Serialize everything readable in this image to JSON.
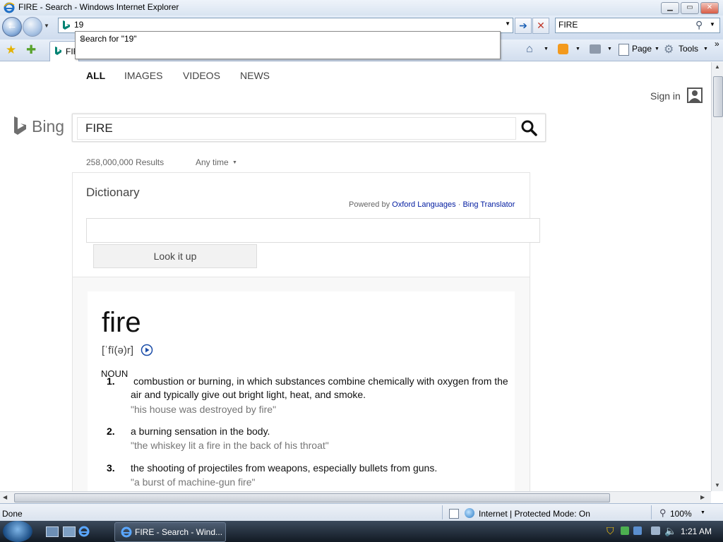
{
  "window": {
    "title": "FIRE - Search - Windows Internet Explorer",
    "controls": {
      "minimize": "▁",
      "maximize": "▭",
      "close": "✕"
    }
  },
  "navbar": {
    "back_glyph": "←",
    "address_value": "19",
    "go_glyph": "➔",
    "stop_glyph": "✕",
    "search_value": "FIRE",
    "search_glyph": "⚲"
  },
  "autocomplete": {
    "suggestion": "Search for \"19\""
  },
  "tab": {
    "label": "FIF"
  },
  "commands": {
    "page": "Page",
    "tools": "Tools",
    "more": "»"
  },
  "bing": {
    "nav": [
      "ALL",
      "IMAGES",
      "VIDEOS",
      "NEWS"
    ],
    "sign_in": "Sign in",
    "logo_text": "Bing",
    "query": "FIRE",
    "results_count": "258,000,000 Results",
    "any_time": "Any time"
  },
  "dictionary": {
    "title": "Dictionary",
    "powered_by": "Powered by",
    "provider": "Oxford Languages",
    "separator": "·",
    "translator": "Bing Translator",
    "lookup_placeholder": "",
    "lookup_button": "Look it up",
    "word": "fire",
    "pronunciation": "[ˈfī(ə)r]",
    "part_of_speech": "NOUN",
    "definitions": [
      {
        "num": "1.",
        "text": "combustion or burning, in which substances combine chemically with oxygen from the air and typically give out bright light, heat, and smoke.",
        "example": "\"his house was destroyed by fire\""
      },
      {
        "num": "2.",
        "text": "a burning sensation in the body.",
        "example": "\"the whiskey lit a fire in the back of his throat\""
      },
      {
        "num": "3.",
        "text": "the shooting of projectiles from weapons, especially bullets from guns.",
        "example": "\"a burst of machine-gun fire\""
      }
    ]
  },
  "statusbar": {
    "left": "Done",
    "zone": "Internet | Protected Mode: On",
    "zoom": "100%"
  },
  "taskbar": {
    "window_label": "FIRE - Search - Wind...",
    "clock": "1:21 AM"
  },
  "colors": {
    "link": "#001ba0",
    "bing_gray": "#666666",
    "accent": "#3e6aa6"
  }
}
